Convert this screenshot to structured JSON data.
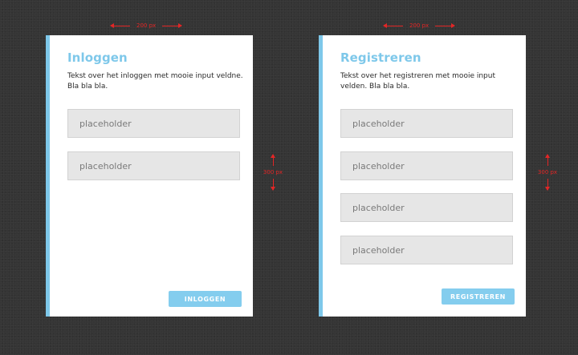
{
  "annotations": {
    "width_label": "200 px",
    "height_label": "300 px"
  },
  "login": {
    "title": "Inloggen",
    "description": "Tekst over het inloggen met mooie input veldne. Bla bla bla.",
    "fields": [
      {
        "placeholder": "placeholder"
      },
      {
        "placeholder": "placeholder"
      }
    ],
    "button_label": "INLOGGEN"
  },
  "register": {
    "title": "Registreren",
    "description": "Tekst over het registreren met mooie input velden. Bla bla bla.",
    "fields": [
      {
        "placeholder": "placeholder"
      },
      {
        "placeholder": "placeholder"
      },
      {
        "placeholder": "placeholder"
      },
      {
        "placeholder": "placeholder"
      }
    ],
    "button_label": "REGISTREREN"
  },
  "colors": {
    "accent": "#7ec8ea",
    "button": "#84cdee",
    "annotation": "#e32626",
    "background": "#353535",
    "field": "#e6e6e6"
  }
}
